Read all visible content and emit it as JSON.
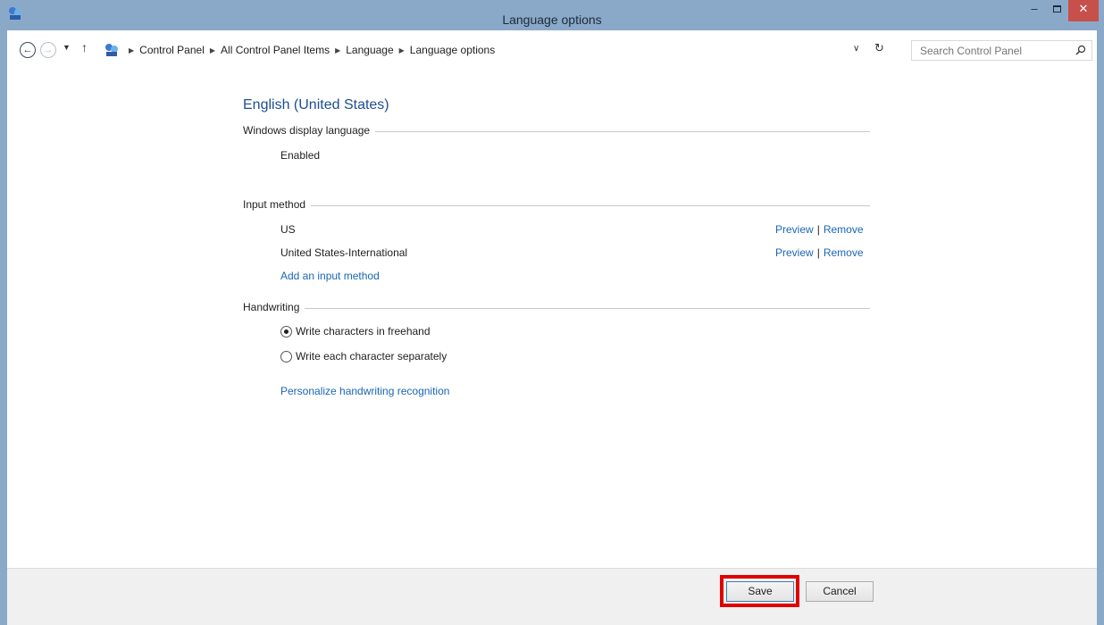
{
  "window": {
    "title": "Language options",
    "minimize_label": "–",
    "close_label": "✕"
  },
  "nav": {
    "back_glyph": "←",
    "forward_glyph": "→",
    "recent_glyph": "▼",
    "up_glyph": "↑"
  },
  "address": {
    "crumbs": [
      "Control Panel",
      "All Control Panel Items",
      "Language",
      "Language options"
    ],
    "separator_glyph": "▶",
    "dropdown_glyph": "∨",
    "refresh_glyph": "↻"
  },
  "search": {
    "placeholder": "Search Control Panel"
  },
  "content": {
    "language_name": "English (United States)",
    "display_language": {
      "heading": "Windows display language",
      "status": "Enabled"
    },
    "input_method": {
      "heading": "Input method",
      "methods": [
        {
          "name": "US",
          "preview": "Preview",
          "remove": "Remove"
        },
        {
          "name": "United States-International",
          "preview": "Preview",
          "remove": "Remove"
        }
      ],
      "actions_separator": "|",
      "add_link": "Add an input method"
    },
    "handwriting": {
      "heading": "Handwriting",
      "options": [
        {
          "label": "Write characters in freehand",
          "selected": true
        },
        {
          "label": "Write each character separately",
          "selected": false
        }
      ],
      "personalize_link": "Personalize handwriting recognition"
    }
  },
  "footer": {
    "save_label": "Save",
    "cancel_label": "Cancel"
  },
  "icons": {
    "app": "control-panel-icon",
    "address": "control-panel-icon",
    "search": "search-icon"
  },
  "colors": {
    "titlebar": "#8aa9c9",
    "close_button": "#c7504a",
    "link": "#1a66b5",
    "heading": "#1e4e8c",
    "highlight": "#e00000"
  }
}
